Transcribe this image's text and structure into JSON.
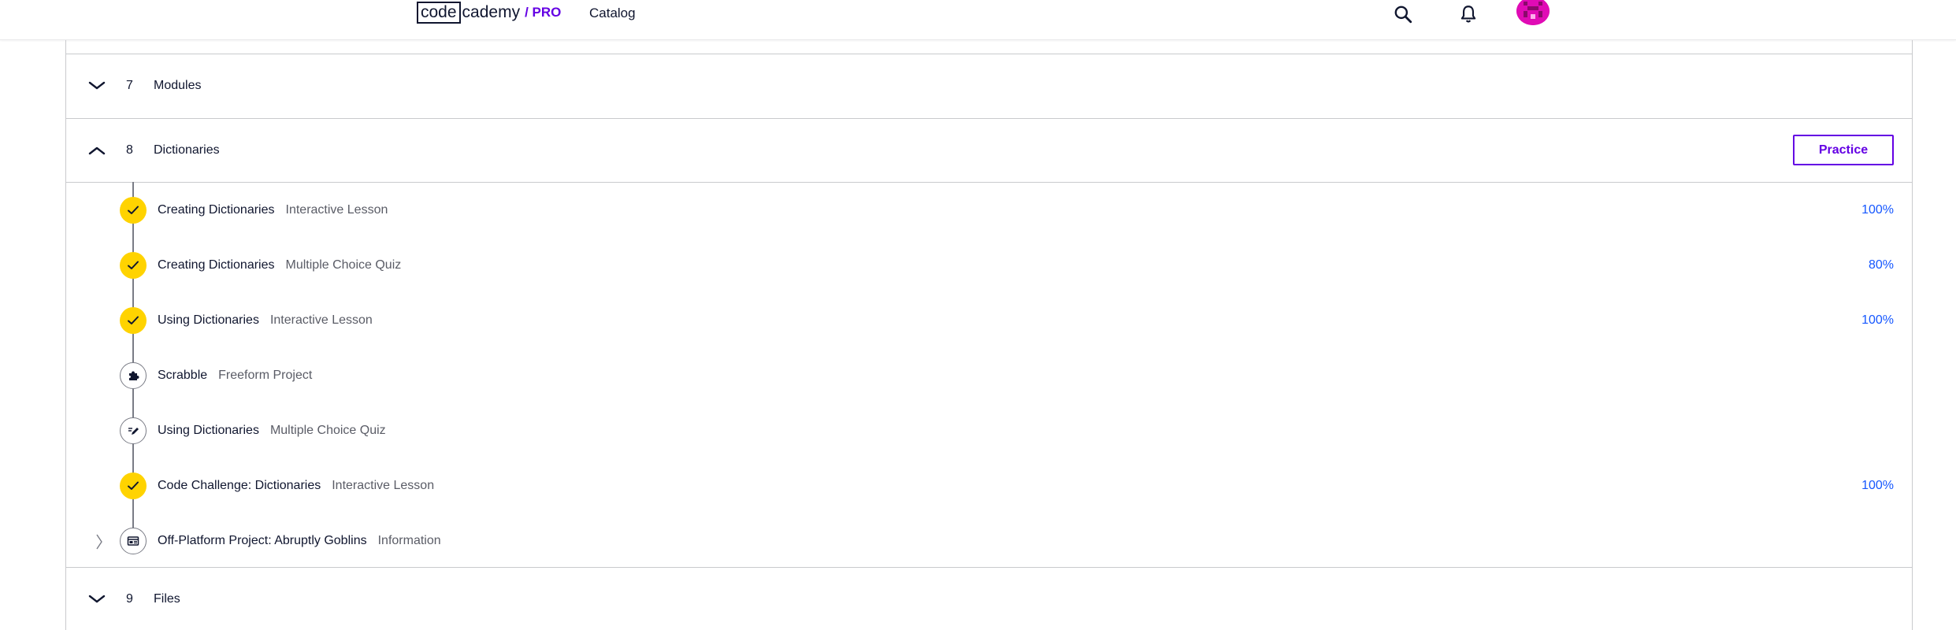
{
  "header": {
    "logo": {
      "code": "code",
      "cademy": "cademy",
      "pro": "/ PRO"
    },
    "nav_catalog": "Catalog",
    "icons": [
      "search-icon",
      "bell-icon",
      "avatar"
    ]
  },
  "modules": [
    {
      "number": "7",
      "name": "Modules",
      "expanded": false
    },
    {
      "number": "8",
      "name": "Dictionaries",
      "expanded": true,
      "practice_label": "Practice",
      "lessons": [
        {
          "title": "Creating Dictionaries",
          "type": "Interactive Lesson",
          "progress": "100%",
          "status": "complete",
          "icon": "check-icon"
        },
        {
          "title": "Creating Dictionaries",
          "type": "Multiple Choice Quiz",
          "progress": "80%",
          "status": "complete",
          "icon": "check-icon"
        },
        {
          "title": "Using Dictionaries",
          "type": "Interactive Lesson",
          "progress": "100%",
          "status": "complete",
          "icon": "check-icon"
        },
        {
          "title": "Scrabble",
          "type": "Freeform Project",
          "progress": "",
          "status": "not-started",
          "icon": "puzzle-icon"
        },
        {
          "title": "Using Dictionaries",
          "type": "Multiple Choice Quiz",
          "progress": "",
          "status": "not-started",
          "icon": "quiz-pencil-icon"
        },
        {
          "title": "Code Challenge: Dictionaries",
          "type": "Interactive Lesson",
          "progress": "100%",
          "status": "complete",
          "icon": "check-icon"
        },
        {
          "title": "Off-Platform Project: Abruptly Goblins",
          "type": "Information",
          "progress": "",
          "status": "not-started",
          "icon": "article-icon"
        }
      ]
    },
    {
      "number": "9",
      "name": "Files",
      "expanded": false
    }
  ],
  "colors": {
    "brand_purple": "#6400e4",
    "complete_yellow": "#ffd300",
    "progress_blue": "#1557ff",
    "text_dark": "#10162f",
    "text_muted": "#5a5c66"
  }
}
